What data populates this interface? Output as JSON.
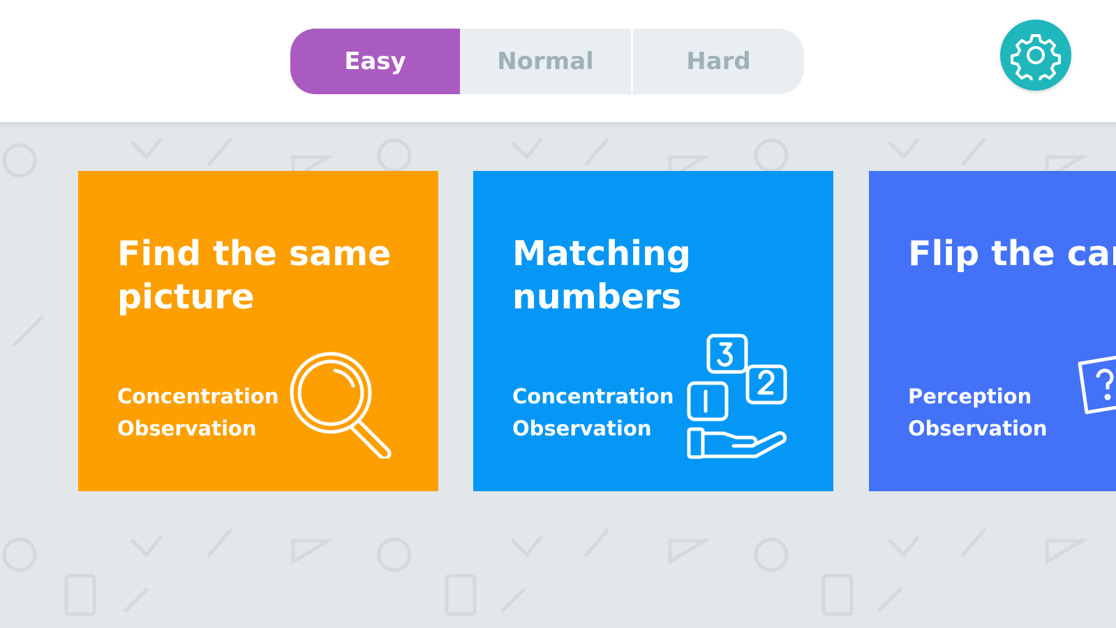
{
  "difficulty": {
    "options": [
      {
        "label": "Easy",
        "selected": true
      },
      {
        "label": "Normal",
        "selected": false
      },
      {
        "label": "Hard",
        "selected": false
      }
    ]
  },
  "settings": {
    "icon": "gear-icon"
  },
  "colors": {
    "easy": "#a95bc1",
    "settings": "#20b7bc",
    "card_orange": "#fd9f00",
    "card_blue": "#0497f5",
    "card_indigo": "#4372f8",
    "board_bg": "#e2e7ea"
  },
  "games": [
    {
      "title": "Find the same picture",
      "skills": [
        "Concentration",
        "Observation"
      ],
      "icon": "magnifier-icon",
      "color": "#fd9f00"
    },
    {
      "title": "Matching numbers",
      "skills": [
        "Concentration",
        "Observation"
      ],
      "icon": "number-blocks-hand-icon",
      "color": "#0497f5"
    },
    {
      "title": "Flip the card",
      "skills": [
        "Perception",
        "Observation"
      ],
      "icon": "question-card-icon",
      "color": "#4372f8"
    }
  ]
}
